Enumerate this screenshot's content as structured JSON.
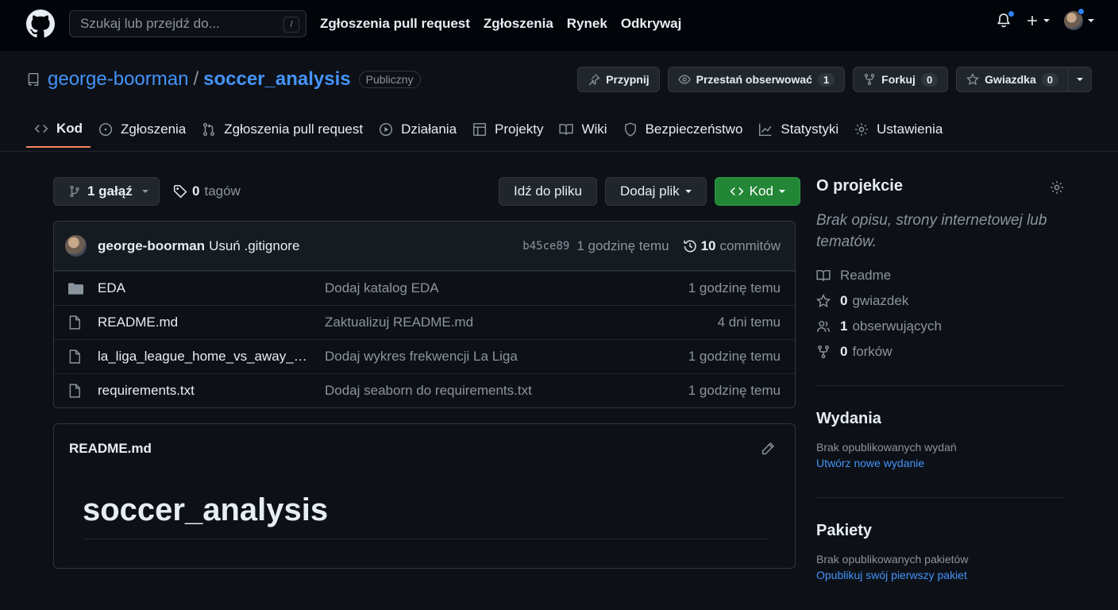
{
  "header": {
    "search_placeholder": "Szukaj lub przejdź do...",
    "search_shortcut": "/",
    "nav": [
      "Zgłoszenia pull request",
      "Zgłoszenia",
      "Rynek",
      "Odkrywaj"
    ]
  },
  "repo": {
    "owner": "george-boorman",
    "separator": "/",
    "name": "soccer_analysis",
    "visibility": "Publiczny",
    "actions": {
      "pin": "Przypnij",
      "watch": "Przestań obserwować",
      "watch_count": "1",
      "fork": "Forkuj",
      "fork_count": "0",
      "star": "Gwiazdka",
      "star_count": "0"
    }
  },
  "tabs": [
    {
      "label": "Kod",
      "icon": "code-icon",
      "active": true
    },
    {
      "label": "Zgłoszenia",
      "icon": "issue-icon"
    },
    {
      "label": "Zgłoszenia pull request",
      "icon": "pull-request-icon"
    },
    {
      "label": "Działania",
      "icon": "play-icon"
    },
    {
      "label": "Projekty",
      "icon": "table-icon"
    },
    {
      "label": "Wiki",
      "icon": "book-icon"
    },
    {
      "label": "Bezpieczeństwo",
      "icon": "shield-icon"
    },
    {
      "label": "Statystyki",
      "icon": "graph-icon"
    },
    {
      "label": "Ustawienia",
      "icon": "gear-icon"
    }
  ],
  "browser": {
    "branch_label": "1 gałąź",
    "tags_count": "0",
    "tags_label": "tagów",
    "goto_file": "Idź do pliku",
    "add_file": "Dodaj plik",
    "code": "Kod"
  },
  "commit": {
    "author": "george-boorman",
    "message": "Usuń .gitignore",
    "sha": "b45ce89",
    "time": "1 godzinę temu",
    "commits_count": "10",
    "commits_label": "commitów"
  },
  "files": [
    {
      "type": "folder",
      "name": "EDA",
      "message": "Dodaj katalog EDA",
      "time": "1 godzinę temu"
    },
    {
      "type": "file",
      "name": "README.md",
      "message": "Zaktualizuj README.md",
      "time": "4 dni temu"
    },
    {
      "type": "file",
      "name": "la_liga_league_home_vs_away_att...",
      "message": "Dodaj wykres frekwencji La Liga",
      "time": "1 godzinę temu"
    },
    {
      "type": "file",
      "name": "requirements.txt",
      "message": "Dodaj seaborn do requirements.txt",
      "time": "1 godzinę temu"
    }
  ],
  "readme": {
    "header": "README.md",
    "title": "soccer_analysis"
  },
  "sidebar": {
    "about_title": "O projekcie",
    "description": "Brak opisu, strony internetowej lub tematów.",
    "readme": "Readme",
    "stars_count": "0",
    "stars_label": "gwiazdek",
    "watchers_count": "1",
    "watchers_label": "obserwujących",
    "forks_count": "0",
    "forks_label": "forków",
    "releases_title": "Wydania",
    "releases_empty": "Brak opublikowanych wydań",
    "releases_link": "Utwórz nowe wydanie",
    "packages_title": "Pakiety",
    "packages_empty": "Brak opublikowanych pakietów",
    "packages_link": "Opublikuj swój pierwszy pakiet"
  },
  "colors": {
    "accent_blue": "#4493f8",
    "tab_underline": "#f78166",
    "green_button": "#238636"
  }
}
